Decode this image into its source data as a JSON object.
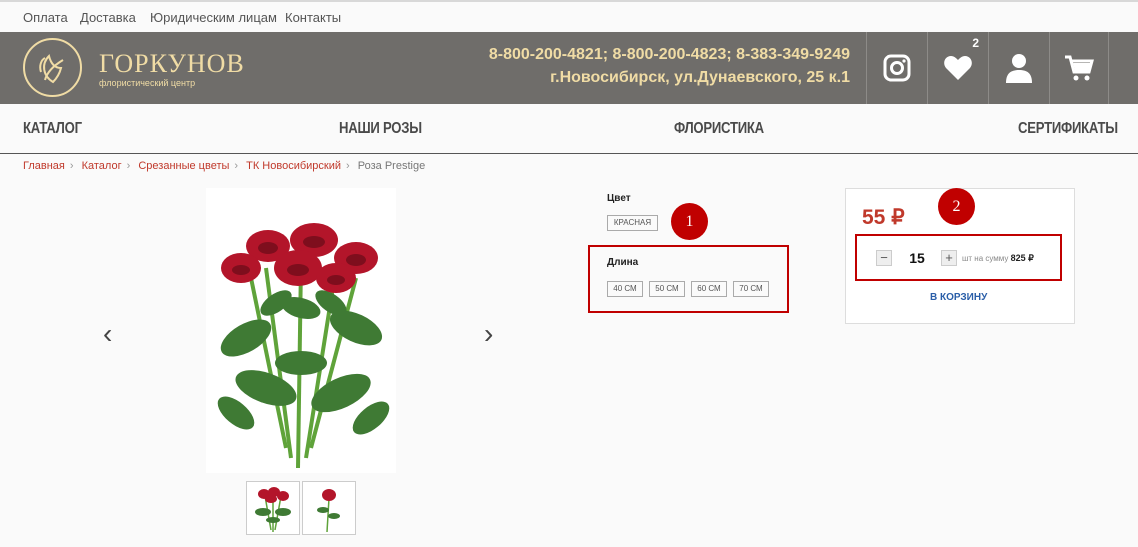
{
  "topbar": {
    "links": [
      "Оплата",
      "Доставка",
      "Юридическим лицам",
      "Контакты"
    ]
  },
  "header": {
    "logo_title": "ГОРКУНОВ",
    "logo_subtitle": "флористический центр",
    "phones": "8-800-200-4821; 8-800-200-4823; 8-383-349-9249",
    "address": "г.Новосибирск, ул.Дунаевского, 25 к.1",
    "wishlist_count": "2",
    "icons": [
      "instagram-icon",
      "heart-icon",
      "user-icon",
      "cart-icon"
    ],
    "bg_color": "#6f6d6a",
    "accent_color": "#f0dca5"
  },
  "nav": {
    "items": [
      "КАТАЛОГ",
      "НАШИ РОЗЫ",
      "ФЛОРИСТИКА",
      "СЕРТИФИКАТЫ"
    ]
  },
  "breadcrumb": {
    "items": [
      "Главная",
      "Каталог",
      "Срезанные цветы",
      "ТК Новосибирский"
    ],
    "current": "Роза Prestige"
  },
  "product": {
    "color_label": "Цвет",
    "color_value": "КРАСНАЯ",
    "length_label": "Длина",
    "lengths": [
      "40 СМ",
      "50 СМ",
      "60 СМ",
      "70 СМ"
    ],
    "price": "55 ₽",
    "quantity": "15",
    "sum_label": "шт на сумму",
    "sum_value": "825 ₽",
    "cart_button": "В КОРЗИНУ",
    "price_color": "#c0392b"
  },
  "annotations": [
    "1",
    "2"
  ]
}
